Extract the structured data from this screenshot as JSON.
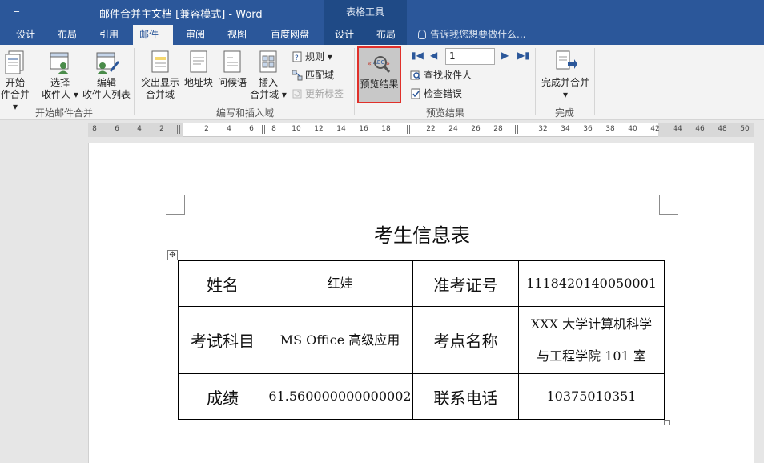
{
  "titlebar": {
    "qat": "=",
    "doc_title": "邮件合并主文档 [兼容模式] - Word",
    "tools_title": "表格工具"
  },
  "tabs": [
    {
      "label": "设计"
    },
    {
      "label": "布局"
    },
    {
      "label": "引用"
    },
    {
      "label": "邮件"
    },
    {
      "label": "审阅"
    },
    {
      "label": "视图"
    },
    {
      "label": "百度网盘"
    },
    {
      "label": "设计"
    },
    {
      "label": "布局"
    }
  ],
  "tellme": "告诉我您想要做什么...",
  "ribbon": {
    "start_merge": {
      "line1": "开始",
      "line2": "件合并 ▾"
    },
    "select_recipients": {
      "line1": "选择",
      "line2": "收件人 ▾"
    },
    "edit_list": {
      "line1": "编辑",
      "line2": "收件人列表"
    },
    "group_start": "开始邮件合并",
    "highlight_fields": {
      "line1": "突出显示",
      "line2": "合并域"
    },
    "address_block": "地址块",
    "greeting": "问候语",
    "insert_field": {
      "line1": "插入",
      "line2": "合并域 ▾"
    },
    "rules": "规则 ▾",
    "match_fields": "匹配域",
    "update_labels": "更新标签",
    "group_write": "编写和插入域",
    "preview_results": "预览结果",
    "record_number": "1",
    "find_recipient": "查找收件人",
    "check_errors": "检查错误",
    "group_preview": "预览结果",
    "finish_merge": {
      "line1": "完成并合并",
      "line2": "▾"
    },
    "group_finish": "完成"
  },
  "ruler": {
    "ticks": [
      "8",
      "6",
      "4",
      "2",
      "2",
      "4",
      "6",
      "8",
      "10",
      "12",
      "14",
      "16",
      "18",
      "22",
      "24",
      "26",
      "28",
      "32",
      "34",
      "36",
      "38",
      "40",
      "42",
      "44",
      "46",
      "48",
      "50"
    ]
  },
  "document": {
    "heading": "考生信息表",
    "table": {
      "row1": {
        "label1": "姓名",
        "value1": "红娃",
        "label2": "准考证号",
        "value2": "1118420140050001"
      },
      "row2": {
        "label1": "考试科目",
        "value1": "MS Office 高级应用",
        "label2": "考点名称",
        "value2_line1": "XXX 大学计算机科学",
        "value2_line2": "与工程学院 101 室"
      },
      "row3": {
        "label1": "成绩",
        "value1": "61.560000000000002",
        "label2": "联系电话",
        "value2": "10375010351"
      }
    }
  },
  "colors": {
    "accent": "#2b579a",
    "highlight_border": "#e0302a"
  }
}
